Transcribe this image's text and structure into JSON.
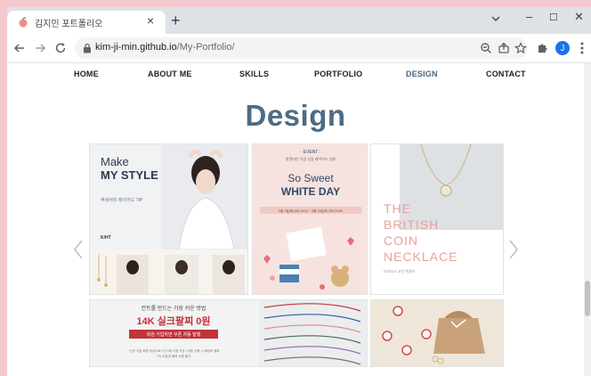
{
  "browser": {
    "tab_title": "김지민 포트폴리오",
    "tab_close": "×",
    "new_tab": "+",
    "url_host": "kim-ji-min.github.io",
    "url_path": "/My-Portfolio/",
    "profile_initial": "J",
    "window_controls": {
      "minimize": "–",
      "maximize": "☐",
      "close": "✕"
    }
  },
  "site": {
    "nav": [
      "HOME",
      "ABOUT ME",
      "SKILLS",
      "PORTFOLIO",
      "DESIGN",
      "CONTACT"
    ],
    "active_nav": "DESIGN",
    "heading": "Design",
    "cards": {
      "card1": {
        "line1": "Make",
        "line2": "MY STYLE",
        "sub": "액세서리 레이어드 TIP",
        "brand": "K/HT"
      },
      "card2": {
        "event": "- EVENT -",
        "sub": "발렌타인 기념 신상 레이어드 선물",
        "line1": "So Sweet",
        "line2": "WHITE DAY",
        "dates": "3월 1일(화) AM 10:00 ~ 3월 12일(토) PM 23:59"
      },
      "card3": {
        "lines": [
          "THE",
          "BRITISH",
          "COIN",
          "NECKLACE"
        ],
        "sub": "브리티시 코인 목걸이"
      },
      "card4": {
        "line1": "컨트롤 만드는 가장 쉬운 방법",
        "line2": "14K 실크팔찌 0원",
        "badge": "회원 가입하면 쿠폰 자동 발행",
        "note1": "* 신규 가입 회원 대상으로 1인 1회 사용 가능 / 쿠폰 사용 시 배송비 별도",
        "note2": "* 타 쿠폰과 중복 사용 불가"
      }
    }
  },
  "colors": {
    "accent": "#4d6b84",
    "active_nav": "#4a6680",
    "card2_title": "#2f4a66",
    "card3_title": "#e9a19c",
    "card4_headline": "#c0343b"
  }
}
